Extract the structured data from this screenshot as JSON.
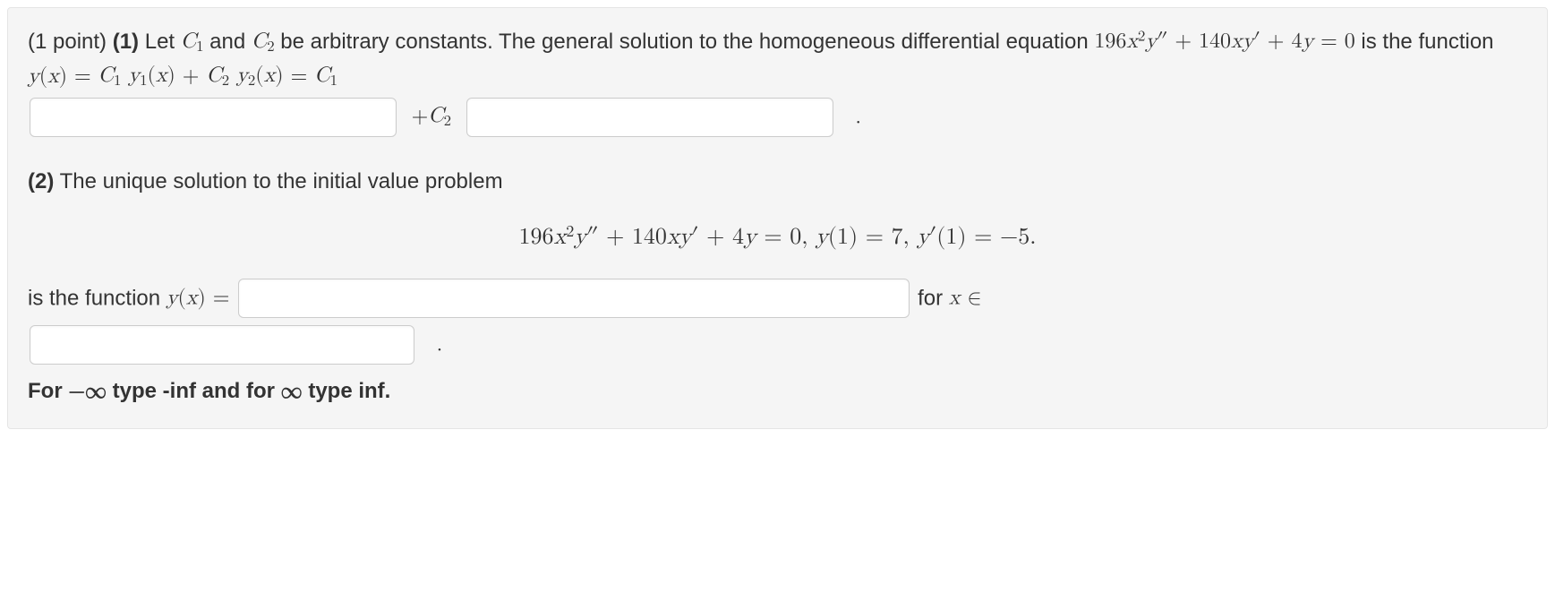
{
  "part1": {
    "points": "(1 point)",
    "label": "(1)",
    "intro_a": "Let ",
    "c1": "C",
    "c1_sub": "1",
    "intro_b": " and ",
    "c2": "C",
    "c2_sub": "2",
    "intro_c": " be arbitrary constants. The general solution to the homogeneous differential equation ",
    "eq_lhs_a": "196",
    "eq_lhs_b": "x",
    "eq_lhs_b_sup": "2",
    "eq_lhs_c": "y",
    "eq_lhs_c_prime": "″",
    "eq_lhs_d": " + 140",
    "eq_lhs_e": "x",
    "eq_lhs_f": "y",
    "eq_lhs_f_prime": "′",
    "eq_lhs_g": " + 4",
    "eq_lhs_h": "y",
    "eq_lhs_i": " = 0",
    "intro_d": " is the function ",
    "yx": "y",
    "yx_paren_l": "(",
    "yx_x": "x",
    "yx_paren_r": ")",
    "eq_eq": " = ",
    "c1b": "C",
    "c1b_sub": "1",
    "sp1": " ",
    "y1": "y",
    "y1_sub": "1",
    "y1_paren_l": "(",
    "y1_x": "x",
    "y1_paren_r": ")",
    "plus": " + ",
    "c2b": "C",
    "c2b_sub": "2",
    "sp2": " ",
    "y2": "y",
    "y2_sub": "2",
    "y2_paren_l": "(",
    "y2_x": "x",
    "y2_paren_r": ")",
    "eq_eq2": " = ",
    "c1c": "C",
    "c1c_sub": "1",
    "plus_c2": "+",
    "c2c": "C",
    "c2c_sub": "2",
    "period": "."
  },
  "part2": {
    "label": "(2)",
    "intro": " The unique solution to the initial value problem",
    "disp_a": "196",
    "disp_b": "x",
    "disp_b_sup": "2",
    "disp_c": "y",
    "disp_c_prime": "″",
    "disp_d": " + 140",
    "disp_e": "x",
    "disp_f": "y",
    "disp_f_prime": "′",
    "disp_g": " + 4",
    "disp_h": "y",
    "disp_i": " = 0,   ",
    "disp_j": "y",
    "disp_k": "(1) = 7,   ",
    "disp_l": "y",
    "disp_l_prime": "′",
    "disp_m": "(1) = −5.",
    "line3a": "is the function ",
    "line3b": "y",
    "line3_paren_l": "(",
    "line3_x": "x",
    "line3_paren_r": ")",
    "line3_eq": " = ",
    "for_x_in_a": " for ",
    "for_x_in_b": "x",
    "for_x_in_c": " ∈",
    "period2": ".",
    "hint_a": "For ",
    "hint_b": "−∞",
    "hint_c": " type -inf and for ",
    "hint_d": "∞",
    "hint_e": " type inf."
  }
}
